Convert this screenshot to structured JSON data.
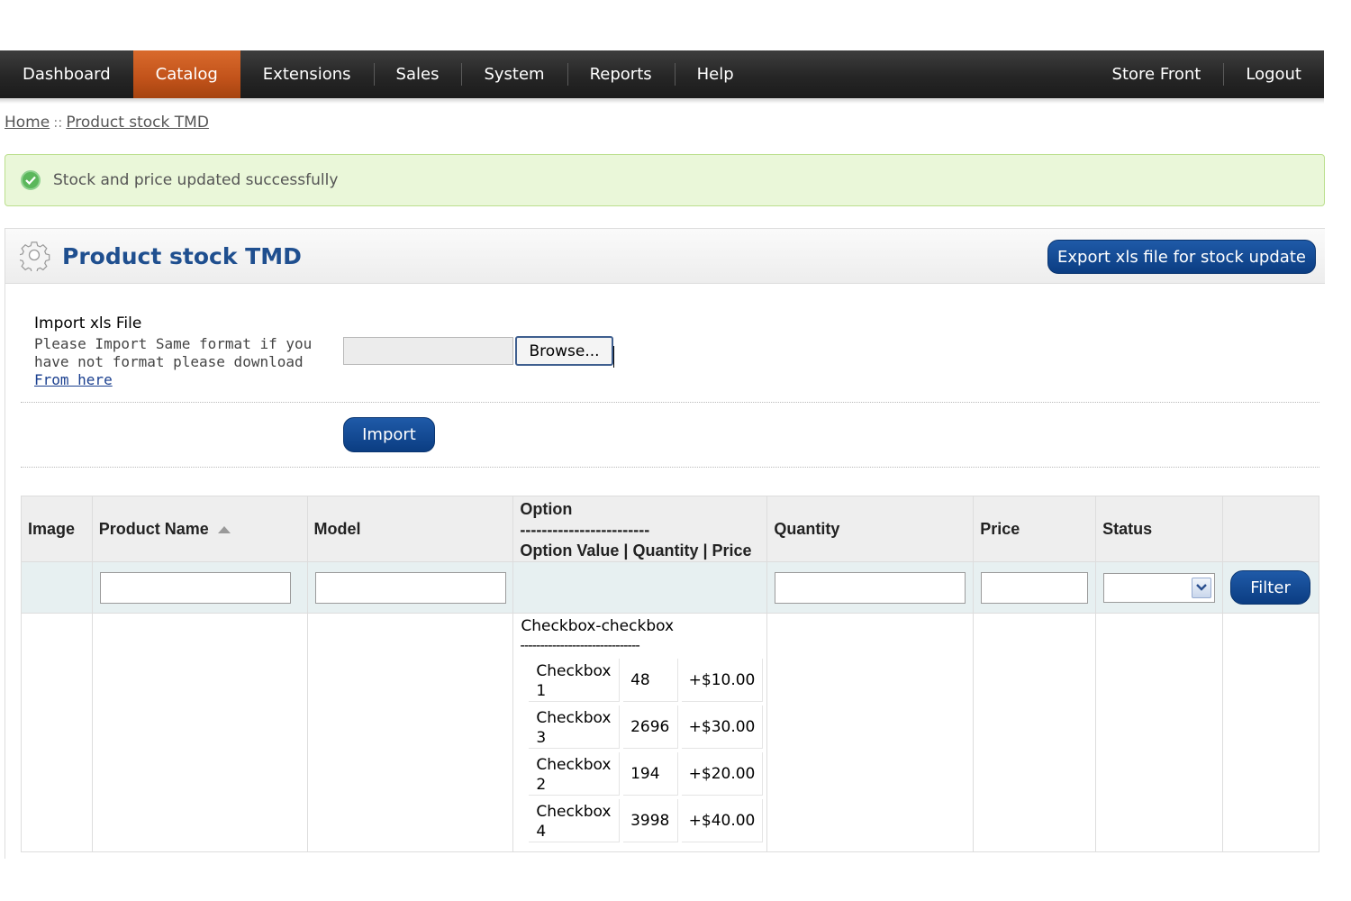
{
  "nav": {
    "left": [
      "Dashboard",
      "Catalog",
      "Extensions",
      "Sales",
      "System",
      "Reports",
      "Help"
    ],
    "right": [
      "Store Front",
      "Logout"
    ],
    "active": "Catalog"
  },
  "breadcrumb": {
    "home": "Home",
    "separator": "::",
    "current": "Product stock TMD"
  },
  "alert": {
    "text": "Stock and price updated successfully"
  },
  "panel": {
    "title": "Product stock TMD",
    "export_label": "Export xls file for stock update",
    "import_label": "Import xls File",
    "import_help": "Please Import Same format if you have not format please download",
    "import_help_link": "From here",
    "browse_label": "Browse...",
    "import_button": "Import"
  },
  "table": {
    "headers": {
      "image": "Image",
      "product_name": "Product Name",
      "model": "Model",
      "option_line1": "Option",
      "option_line2": "------------------------",
      "option_line3": "Option Value | Quantity | Price",
      "quantity": "Quantity",
      "price": "Price",
      "status": "Status"
    },
    "filter_button": "Filter",
    "rows": [
      {
        "option_group": "Checkbox-checkbox",
        "option_dash": "------------------------------",
        "options": [
          {
            "value": "Checkbox 1",
            "quantity": "48",
            "price": "+$10.00"
          },
          {
            "value": "Checkbox 3",
            "quantity": "2696",
            "price": "+$30.00"
          },
          {
            "value": "Checkbox 2",
            "quantity": "194",
            "price": "+$20.00"
          },
          {
            "value": "Checkbox 4",
            "quantity": "3998",
            "price": "+$40.00"
          }
        ]
      }
    ]
  },
  "colors": {
    "nav_active": "#c1521a",
    "accent_blue": "#0b3d82",
    "alert_bg": "#eaf7d9",
    "title": "#1f4f8f"
  }
}
